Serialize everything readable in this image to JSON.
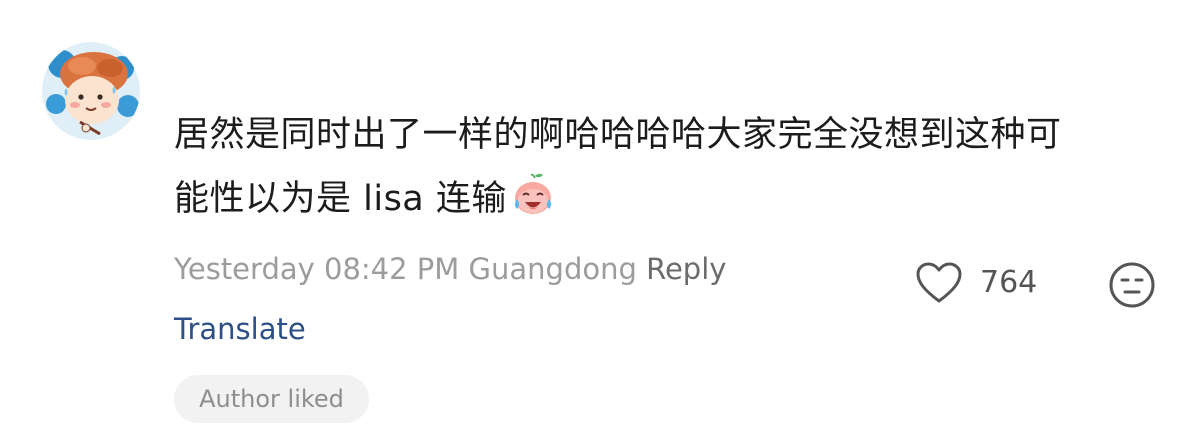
{
  "comment": {
    "text_line1": "居然是同时出了一样的啊哈哈哈哈大家完全没想到这种可",
    "text_line2": "能性以为是 lisa 连输",
    "emoji": "crying-laughing-face-emoji",
    "timestamp": "Yesterday 08:42 PM",
    "location": "Guangdong",
    "reply_label": "Reply",
    "translate_label": "Translate",
    "author_badge": "Author liked",
    "like_count": "764"
  },
  "icons": {
    "avatar": "cartoon-avatar",
    "like": "heart-outline-icon",
    "dislike": "neutral-face-icon"
  },
  "colors": {
    "text": "#1c1c1c",
    "meta": "#9c9c9c",
    "translate": "#2b4f86",
    "badge_bg": "#f2f2f2"
  }
}
